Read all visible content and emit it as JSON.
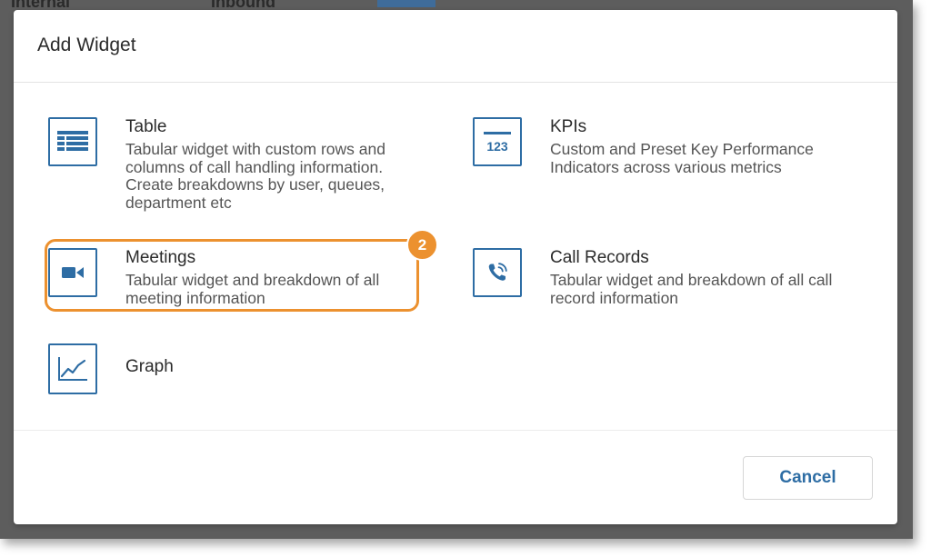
{
  "background": {
    "text_left": "Internal",
    "text_mid": "Inbound"
  },
  "modal": {
    "title": "Add Widget"
  },
  "widgets": [
    {
      "title": "Table",
      "description": "Tabular widget with custom rows and columns of call handling information. Create breakdowns by user, queues, department etc",
      "icon": "table-icon"
    },
    {
      "title": "KPIs",
      "description": "Custom and Preset Key Performance Indicators across various metrics",
      "icon": "kpi-123-icon",
      "icon_text": "123"
    },
    {
      "title": "Meetings",
      "description": "Tabular widget and breakdown of all meeting information",
      "icon": "video-camera-icon"
    },
    {
      "title": "Call Records",
      "description": "Tabular widget and breakdown of all call record information",
      "icon": "phone-call-icon"
    },
    {
      "title": "Graph",
      "description": "",
      "icon": "line-graph-icon"
    }
  ],
  "callout": {
    "step_number": "2"
  },
  "footer": {
    "cancel_label": "Cancel"
  },
  "colors": {
    "accent_blue": "#2e6da4",
    "highlight_orange": "#ec912f"
  }
}
